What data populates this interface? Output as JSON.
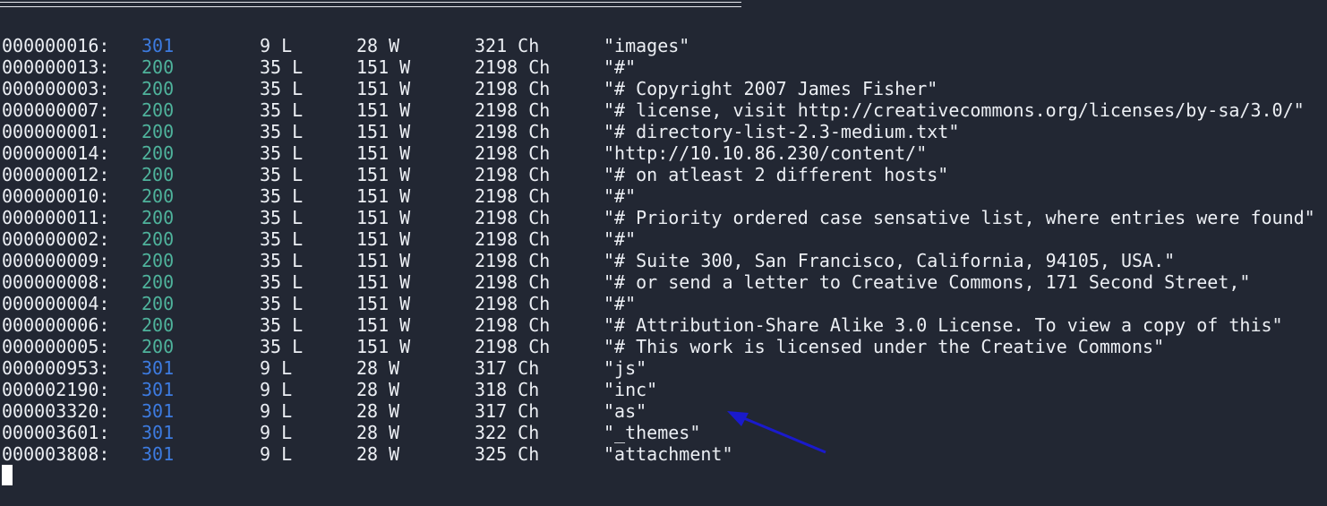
{
  "theme": {
    "background": "#222733",
    "foreground": "#eceff4",
    "status_301_color": "#3d7be0",
    "status_200_color": "#4fb39c",
    "arrow_color": "#1a1acc"
  },
  "results": [
    {
      "id": "000000016:",
      "code": "301",
      "lines": "9 L",
      "words": "28 W",
      "chars": "321 Ch",
      "payload": "\"images\""
    },
    {
      "id": "000000013:",
      "code": "200",
      "lines": "35 L",
      "words": "151 W",
      "chars": "2198 Ch",
      "payload": "\"#\""
    },
    {
      "id": "000000003:",
      "code": "200",
      "lines": "35 L",
      "words": "151 W",
      "chars": "2198 Ch",
      "payload": "\"# Copyright 2007 James Fisher\""
    },
    {
      "id": "000000007:",
      "code": "200",
      "lines": "35 L",
      "words": "151 W",
      "chars": "2198 Ch",
      "payload": "\"# license, visit http://creativecommons.org/licenses/by-sa/3.0/\""
    },
    {
      "id": "000000001:",
      "code": "200",
      "lines": "35 L",
      "words": "151 W",
      "chars": "2198 Ch",
      "payload": "\"# directory-list-2.3-medium.txt\""
    },
    {
      "id": "000000014:",
      "code": "200",
      "lines": "35 L",
      "words": "151 W",
      "chars": "2198 Ch",
      "payload": "\"http://10.10.86.230/content/\""
    },
    {
      "id": "000000012:",
      "code": "200",
      "lines": "35 L",
      "words": "151 W",
      "chars": "2198 Ch",
      "payload": "\"# on atleast 2 different hosts\""
    },
    {
      "id": "000000010:",
      "code": "200",
      "lines": "35 L",
      "words": "151 W",
      "chars": "2198 Ch",
      "payload": "\"#\""
    },
    {
      "id": "000000011:",
      "code": "200",
      "lines": "35 L",
      "words": "151 W",
      "chars": "2198 Ch",
      "payload": "\"# Priority ordered case sensative list, where entries were found\""
    },
    {
      "id": "000000002:",
      "code": "200",
      "lines": "35 L",
      "words": "151 W",
      "chars": "2198 Ch",
      "payload": "\"#\""
    },
    {
      "id": "000000009:",
      "code": "200",
      "lines": "35 L",
      "words": "151 W",
      "chars": "2198 Ch",
      "payload": "\"# Suite 300, San Francisco, California, 94105, USA.\""
    },
    {
      "id": "000000008:",
      "code": "200",
      "lines": "35 L",
      "words": "151 W",
      "chars": "2198 Ch",
      "payload": "\"# or send a letter to Creative Commons, 171 Second Street,\""
    },
    {
      "id": "000000004:",
      "code": "200",
      "lines": "35 L",
      "words": "151 W",
      "chars": "2198 Ch",
      "payload": "\"#\""
    },
    {
      "id": "000000006:",
      "code": "200",
      "lines": "35 L",
      "words": "151 W",
      "chars": "2198 Ch",
      "payload": "\"# Attribution-Share Alike 3.0 License. To view a copy of this\""
    },
    {
      "id": "000000005:",
      "code": "200",
      "lines": "35 L",
      "words": "151 W",
      "chars": "2198 Ch",
      "payload": "\"# This work is licensed under the Creative Commons\""
    },
    {
      "id": "000000953:",
      "code": "301",
      "lines": "9 L",
      "words": "28 W",
      "chars": "317 Ch",
      "payload": "\"js\""
    },
    {
      "id": "000002190:",
      "code": "301",
      "lines": "9 L",
      "words": "28 W",
      "chars": "318 Ch",
      "payload": "\"inc\""
    },
    {
      "id": "000003320:",
      "code": "301",
      "lines": "9 L",
      "words": "28 W",
      "chars": "317 Ch",
      "payload": "\"as\""
    },
    {
      "id": "000003601:",
      "code": "301",
      "lines": "9 L",
      "words": "28 W",
      "chars": "322 Ch",
      "payload": "\"_themes\""
    },
    {
      "id": "000003808:",
      "code": "301",
      "lines": "9 L",
      "words": "28 W",
      "chars": "325 Ch",
      "payload": "\"attachment\""
    }
  ]
}
